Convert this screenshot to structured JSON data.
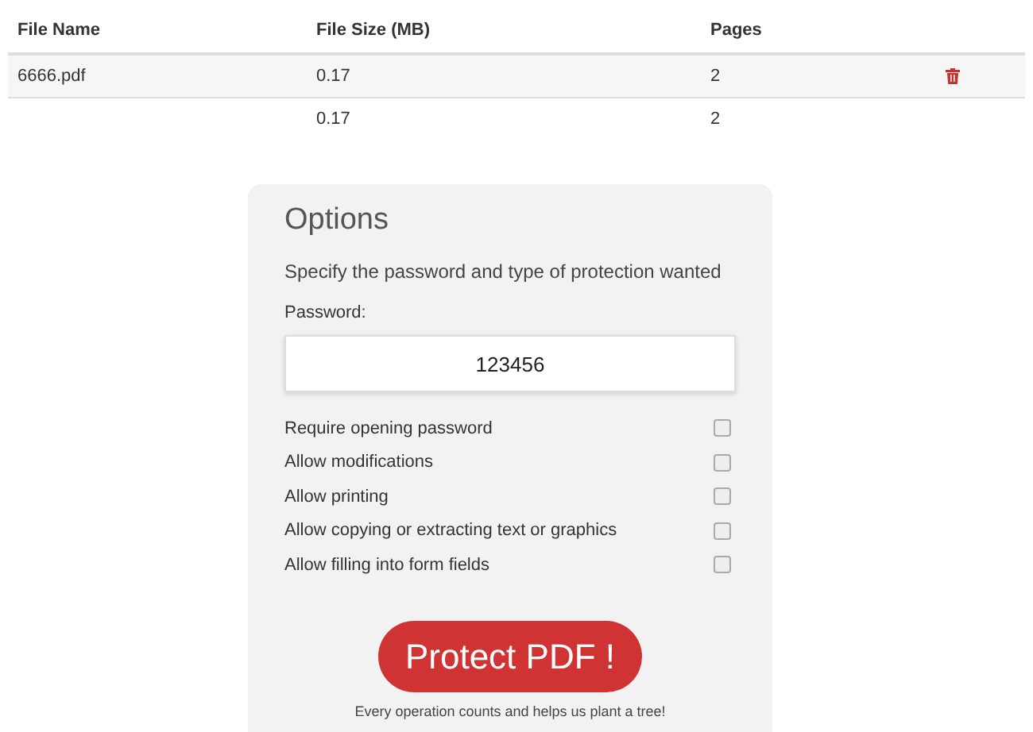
{
  "table": {
    "columns": [
      "File Name",
      "File Size (MB)",
      "Pages"
    ],
    "rows": [
      {
        "file_name": "6666.pdf",
        "file_size": "0.17",
        "pages": "2",
        "deletable": true
      },
      {
        "file_size": "0.17",
        "pages": "2",
        "deletable": false
      }
    ]
  },
  "options": {
    "title": "Options",
    "subtitle": "Specify the password and type of protection wanted",
    "password_label": "Password:",
    "password_value": "123456",
    "checkboxes": [
      {
        "label": "Require opening password",
        "checked": false
      },
      {
        "label": "Allow modifications",
        "checked": false
      },
      {
        "label": "Allow printing",
        "checked": false
      },
      {
        "label": "Allow copying or extracting text or graphics",
        "checked": false
      },
      {
        "label": "Allow filling into form fields",
        "checked": false
      }
    ],
    "button": "Protect PDF !",
    "note": "Every operation counts and helps us plant a tree!"
  }
}
